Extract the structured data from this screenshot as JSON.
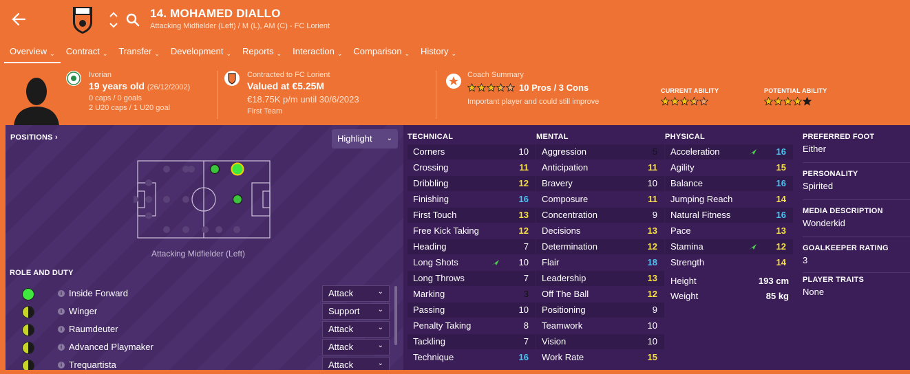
{
  "header": {
    "player_name": "14. MOHAMED DIALLO",
    "subtitle": "Attacking Midfielder (Left) / M (L), AM (C) - FC Lorient",
    "icons": [
      "back-arrow-icon",
      "club-crest-icon",
      "up-down-arrows-icon",
      "search-icon"
    ]
  },
  "tabs": [
    {
      "label": "Overview"
    },
    {
      "label": "Contract"
    },
    {
      "label": "Transfer"
    },
    {
      "label": "Development"
    },
    {
      "label": "Reports"
    },
    {
      "label": "Interaction"
    },
    {
      "label": "Comparison"
    },
    {
      "label": "History"
    }
  ],
  "info": {
    "nationality": "Ivorian",
    "age": "19 years old",
    "dob": "(26/12/2002)",
    "caps": "0 caps / 0 goals",
    "u20": "2 U20 caps / 1 U20 goal",
    "contract_label": "Contracted to FC Lorient",
    "value": "Valued at €5.25M",
    "wage": "€18.75K p/m until 30/6/2023",
    "squad": "First Team",
    "coach_label": "Coach Summary",
    "coach_rating": 3.5,
    "pros_cons": "10 Pros / 3 Cons",
    "coach_note": "Important player and could still improve",
    "current_ability_label": "CURRENT ABILITY",
    "current_ability_stars": 3.5,
    "potential_ability_label": "POTENTIAL ABILITY",
    "potential_ability_stars": 5
  },
  "positions": {
    "title": "POSITIONS",
    "highlight_label": "Highlight",
    "caption": "Attacking Midfielder (Left)"
  },
  "roles": {
    "title": "ROLE AND DUTY",
    "items": [
      {
        "name": "Inside Forward",
        "duty": "Attack",
        "rating": "full"
      },
      {
        "name": "Winger",
        "duty": "Support",
        "rating": "half"
      },
      {
        "name": "Raumdeuter",
        "duty": "Attack",
        "rating": "half"
      },
      {
        "name": "Advanced Playmaker",
        "duty": "Attack",
        "rating": "half"
      },
      {
        "name": "Trequartista",
        "duty": "Attack",
        "rating": "half"
      }
    ]
  },
  "colors": {
    "orange": "#ee7233",
    "panel": "#3b1d58",
    "white": "#ffffff",
    "yellow": "#f5e043",
    "cyan": "#4cc3f0",
    "green": "#3ee83e"
  },
  "technical": {
    "title": "TECHNICAL",
    "rows": [
      {
        "name": "Corners",
        "value": "10"
      },
      {
        "name": "Crossing",
        "value": "11"
      },
      {
        "name": "Dribbling",
        "value": "12"
      },
      {
        "name": "Finishing",
        "value": "16"
      },
      {
        "name": "First Touch",
        "value": "13"
      },
      {
        "name": "Free Kick Taking",
        "value": "12"
      },
      {
        "name": "Heading",
        "value": "7"
      },
      {
        "name": "Long Shots",
        "value": "10",
        "trend": "up"
      },
      {
        "name": "Long Throws",
        "value": "7"
      },
      {
        "name": "Marking",
        "value": "3"
      },
      {
        "name": "Passing",
        "value": "10"
      },
      {
        "name": "Penalty Taking",
        "value": "8"
      },
      {
        "name": "Tackling",
        "value": "7"
      },
      {
        "name": "Technique",
        "value": "16"
      }
    ]
  },
  "mental": {
    "title": "MENTAL",
    "rows": [
      {
        "name": "Aggression",
        "value": "5"
      },
      {
        "name": "Anticipation",
        "value": "11"
      },
      {
        "name": "Bravery",
        "value": "10"
      },
      {
        "name": "Composure",
        "value": "11"
      },
      {
        "name": "Concentration",
        "value": "9"
      },
      {
        "name": "Decisions",
        "value": "13"
      },
      {
        "name": "Determination",
        "value": "12"
      },
      {
        "name": "Flair",
        "value": "18"
      },
      {
        "name": "Leadership",
        "value": "13"
      },
      {
        "name": "Off The Ball",
        "value": "12"
      },
      {
        "name": "Positioning",
        "value": "9"
      },
      {
        "name": "Teamwork",
        "value": "10"
      },
      {
        "name": "Vision",
        "value": "10"
      },
      {
        "name": "Work Rate",
        "value": "15"
      }
    ]
  },
  "physical": {
    "title": "PHYSICAL",
    "rows": [
      {
        "name": "Acceleration",
        "value": "16",
        "trend": "up"
      },
      {
        "name": "Agility",
        "value": "15"
      },
      {
        "name": "Balance",
        "value": "16"
      },
      {
        "name": "Jumping Reach",
        "value": "14"
      },
      {
        "name": "Natural Fitness",
        "value": "16"
      },
      {
        "name": "Pace",
        "value": "13"
      },
      {
        "name": "Stamina",
        "value": "12",
        "trend": "up"
      },
      {
        "name": "Strength",
        "value": "14"
      }
    ],
    "height_label": "Height",
    "height": "193 cm",
    "weight_label": "Weight",
    "weight": "85 kg"
  },
  "side": {
    "preferred_foot_label": "PREFERRED FOOT",
    "preferred_foot": "Either",
    "personality_label": "PERSONALITY",
    "personality": "Spirited",
    "media_label": "MEDIA DESCRIPTION",
    "media": "Wonderkid",
    "gk_label": "GOALKEEPER RATING",
    "gk": "3",
    "traits_label": "PLAYER TRAITS",
    "traits": "None"
  }
}
